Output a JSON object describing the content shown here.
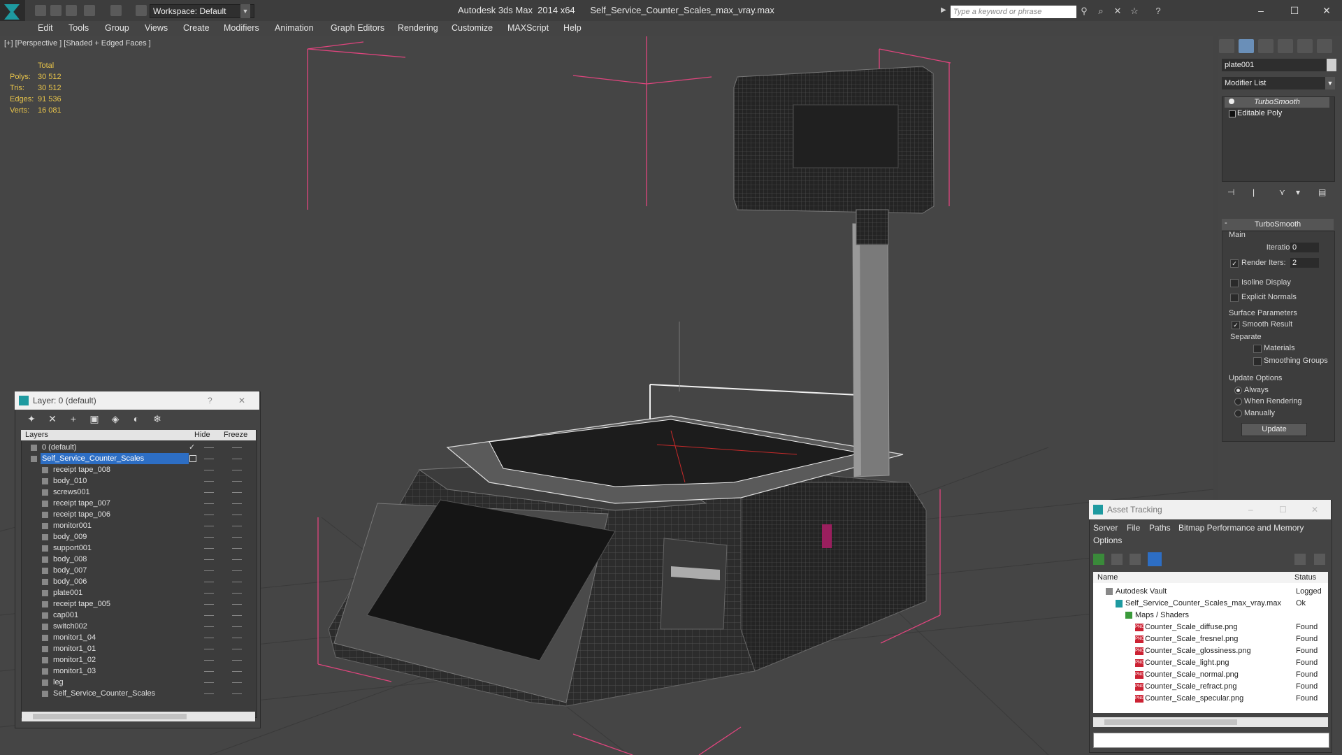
{
  "titlebar": {
    "workspace": "Workspace: Default",
    "app_title": "Autodesk 3ds Max  2014 x64",
    "file_name": "Self_Service_Counter_Scales_max_vray.max",
    "search_placeholder": "Type a keyword or phrase"
  },
  "menu": [
    "Edit",
    "Tools",
    "Group",
    "Views",
    "Create",
    "Modifiers",
    "Animation",
    "Graph Editors",
    "Rendering",
    "Customize",
    "MAXScript",
    "Help"
  ],
  "viewport": {
    "label": "[+] [Perspective ] [Shaded + Edged Faces ]",
    "stats": {
      "header": "Total",
      "rows": [
        {
          "label": "Polys:",
          "value": "30 512"
        },
        {
          "label": "Tris:",
          "value": "30 512"
        },
        {
          "label": "Edges:",
          "value": "91 536"
        },
        {
          "label": "Verts:",
          "value": "16 081"
        }
      ]
    }
  },
  "command_panel": {
    "object_name": "plate001",
    "modifier_list": "Modifier List",
    "stack": [
      "TurboSmooth",
      "Editable Poly"
    ],
    "turbosmooth": {
      "title": "TurboSmooth",
      "main_label": "Main",
      "iterations_label": "Iterations:",
      "iterations_value": "0",
      "render_iters_label": "Render Iters:",
      "render_iters_value": "2",
      "render_iters_checked": true,
      "isoline_label": "Isoline Display",
      "explicit_normals_label": "Explicit Normals",
      "surface_params_label": "Surface Parameters",
      "smooth_result_label": "Smooth Result",
      "smooth_result_checked": true,
      "separate_label": "Separate",
      "materials_label": "Materials",
      "smoothing_groups_label": "Smoothing Groups",
      "update_options_label": "Update Options",
      "always_label": "Always",
      "when_rendering_label": "When Rendering",
      "manually_label": "Manually",
      "update_button": "Update"
    }
  },
  "layer_dialog": {
    "title": "Layer: 0 (default)",
    "help": "?",
    "close": "✕",
    "columns": {
      "layers": "Layers",
      "hide": "Hide",
      "freeze": "Freeze"
    },
    "rows": [
      {
        "name": "0 (default)",
        "level": 0,
        "checked": true
      },
      {
        "name": "Self_Service_Counter_Scales",
        "level": 0,
        "selected": true
      },
      {
        "name": "receipt tape_008",
        "level": 1
      },
      {
        "name": "body_010",
        "level": 1
      },
      {
        "name": "screws001",
        "level": 1
      },
      {
        "name": "receipt tape_007",
        "level": 1
      },
      {
        "name": "receipt tape_006",
        "level": 1
      },
      {
        "name": "monitor001",
        "level": 1
      },
      {
        "name": "body_009",
        "level": 1
      },
      {
        "name": "support001",
        "level": 1
      },
      {
        "name": "body_008",
        "level": 1
      },
      {
        "name": "body_007",
        "level": 1
      },
      {
        "name": "body_006",
        "level": 1
      },
      {
        "name": "plate001",
        "level": 1
      },
      {
        "name": "receipt tape_005",
        "level": 1
      },
      {
        "name": "cap001",
        "level": 1
      },
      {
        "name": "switch002",
        "level": 1
      },
      {
        "name": "monitor1_04",
        "level": 1
      },
      {
        "name": "monitor1_01",
        "level": 1
      },
      {
        "name": "monitor1_02",
        "level": 1
      },
      {
        "name": "monitor1_03",
        "level": 1
      },
      {
        "name": "leg",
        "level": 1
      },
      {
        "name": "Self_Service_Counter_Scales",
        "level": 1
      }
    ]
  },
  "asset_tracking": {
    "title": "Asset Tracking",
    "menu": [
      "Server",
      "File",
      "Paths",
      "Bitmap Performance and Memory",
      "Options"
    ],
    "columns": {
      "name": "Name",
      "status": "Status"
    },
    "rows": [
      {
        "name": "Autodesk Vault",
        "status": "Logged O",
        "level": 0,
        "icon": "vault"
      },
      {
        "name": "Self_Service_Counter_Scales_max_vray.max",
        "status": "Ok",
        "level": 1,
        "icon": "max"
      },
      {
        "name": "Maps / Shaders",
        "status": "",
        "level": 2,
        "icon": "folder"
      },
      {
        "name": "Counter_Scale_diffuse.png",
        "status": "Found",
        "level": 3,
        "icon": "png"
      },
      {
        "name": "Counter_Scale_fresnel.png",
        "status": "Found",
        "level": 3,
        "icon": "png"
      },
      {
        "name": "Counter_Scale_glossiness.png",
        "status": "Found",
        "level": 3,
        "icon": "png"
      },
      {
        "name": "Counter_Scale_light.png",
        "status": "Found",
        "level": 3,
        "icon": "png"
      },
      {
        "name": "Counter_Scale_normal.png",
        "status": "Found",
        "level": 3,
        "icon": "png"
      },
      {
        "name": "Counter_Scale_refract.png",
        "status": "Found",
        "level": 3,
        "icon": "png"
      },
      {
        "name": "Counter_Scale_specular.png",
        "status": "Found",
        "level": 3,
        "icon": "png"
      }
    ]
  },
  "colors": {
    "stats": "#e8c44a",
    "selection": "#2d6ec4",
    "bbox": "#e0457e"
  }
}
